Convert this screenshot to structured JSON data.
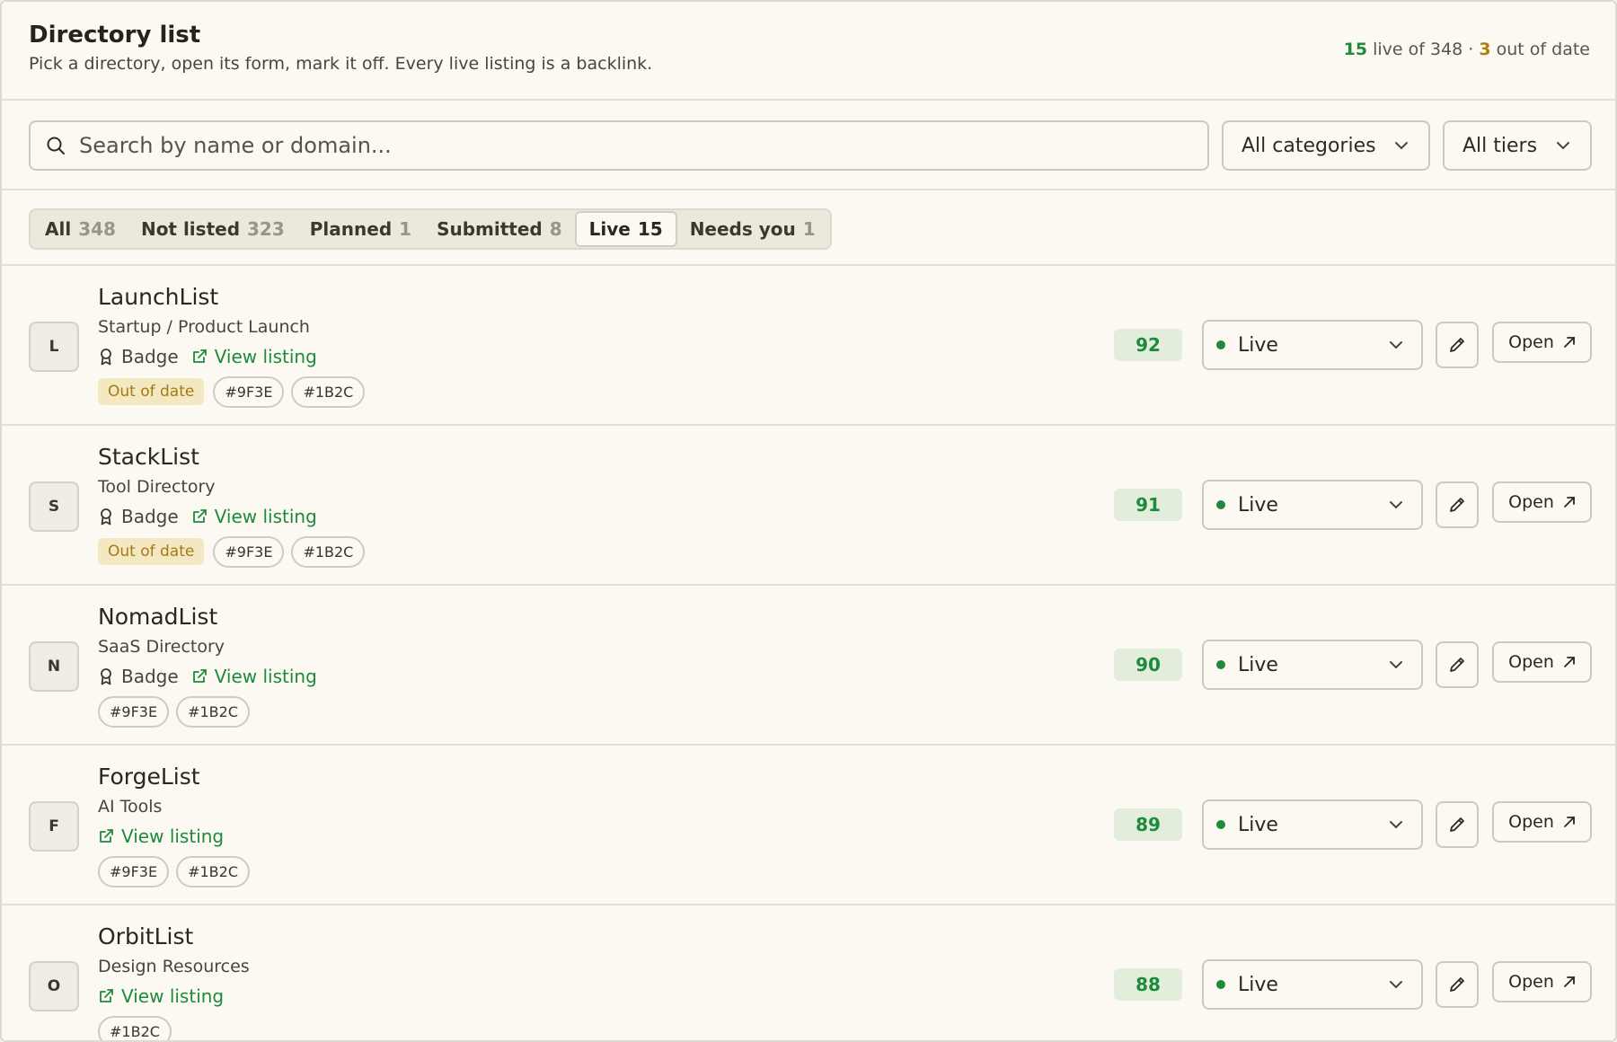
{
  "header": {
    "title": "Directory list",
    "subtitle": "Pick a directory, open its form, mark it off. Every live listing is a backlink.",
    "summary": {
      "live_count": "15",
      "live_text": " live of 348 · ",
      "ood_count": "3",
      "ood_text": " out of date"
    }
  },
  "filters": {
    "search_placeholder": "Search by name or domain...",
    "category_select": "All categories",
    "tier_select": "All tiers"
  },
  "tabs": [
    {
      "label": "All",
      "count": "348"
    },
    {
      "label": "Not listed",
      "count": "323"
    },
    {
      "label": "Planned",
      "count": "1"
    },
    {
      "label": "Submitted",
      "count": "8"
    },
    {
      "label": "Live",
      "count": "15",
      "active": true
    },
    {
      "label": "Needs you",
      "count": "1"
    }
  ],
  "rows": [
    {
      "initial": "L",
      "name": "LaunchList",
      "category": "Startup / Product Launch",
      "badge": "Badge",
      "view_link": "View listing",
      "out_of_date": "Out of date",
      "tags": [
        "#9F3E",
        "#1B2C"
      ],
      "score": "92",
      "status": "Live",
      "open": "Open"
    },
    {
      "initial": "S",
      "name": "StackList",
      "category": "Tool Directory",
      "badge": "Badge",
      "view_link": "View listing",
      "out_of_date": "Out of date",
      "tags": [
        "#9F3E",
        "#1B2C"
      ],
      "score": "91",
      "status": "Live",
      "open": "Open"
    },
    {
      "initial": "N",
      "name": "NomadList",
      "category": "SaaS Directory",
      "badge": "Badge",
      "view_link": "View listing",
      "out_of_date": "",
      "tags": [
        "#9F3E",
        "#1B2C"
      ],
      "score": "90",
      "status": "Live",
      "open": "Open"
    },
    {
      "initial": "F",
      "name": "ForgeList",
      "category": "AI Tools",
      "badge": "",
      "view_link": "View listing",
      "out_of_date": "",
      "tags": [
        "#9F3E",
        "#1B2C"
      ],
      "score": "89",
      "status": "Live",
      "open": "Open"
    },
    {
      "initial": "O",
      "name": "OrbitList",
      "category": "Design Resources",
      "badge": "",
      "view_link": "View listing",
      "out_of_date": "",
      "tags": [
        "#1B2C"
      ],
      "score": "88",
      "status": "Live",
      "open": "Open"
    }
  ],
  "colors": {
    "accent_green": "#1d8a3c",
    "warning_amber": "#b07e0e",
    "background": "#fbf9f2"
  },
  "icons": {
    "search": "search-icon",
    "chevron": "chevron-down-icon",
    "badge": "award-icon",
    "view": "external-link-icon",
    "edit": "pencil-icon",
    "open": "arrow-up-right-icon"
  }
}
